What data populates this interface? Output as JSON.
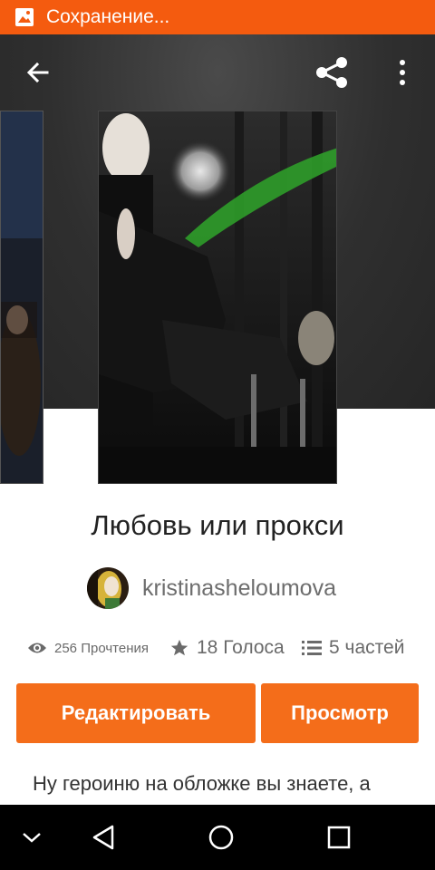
{
  "status_bar": {
    "text": "Сохранение..."
  },
  "story": {
    "title": "Любовь или прокси",
    "author": "kristinasheloumova",
    "reads": "256 Прочтения",
    "votes": "18 Голоса",
    "parts": "5 частей",
    "description": "Ну героиню на обложке вы знаете, а"
  },
  "buttons": {
    "edit": "Редактировать",
    "view": "Просмотр"
  },
  "icons": {
    "status": "image-icon",
    "back": "arrow-left-icon",
    "share": "share-icon",
    "more": "more-vertical-icon",
    "reads": "eye-icon",
    "votes": "star-icon",
    "parts": "list-icon",
    "nav_hide": "chevron-down-icon",
    "nav_back": "triangle-back-icon",
    "nav_home": "circle-home-icon",
    "nav_recent": "square-recent-icon"
  },
  "colors": {
    "accent": "#f45b0f",
    "button": "#f46d1a"
  }
}
